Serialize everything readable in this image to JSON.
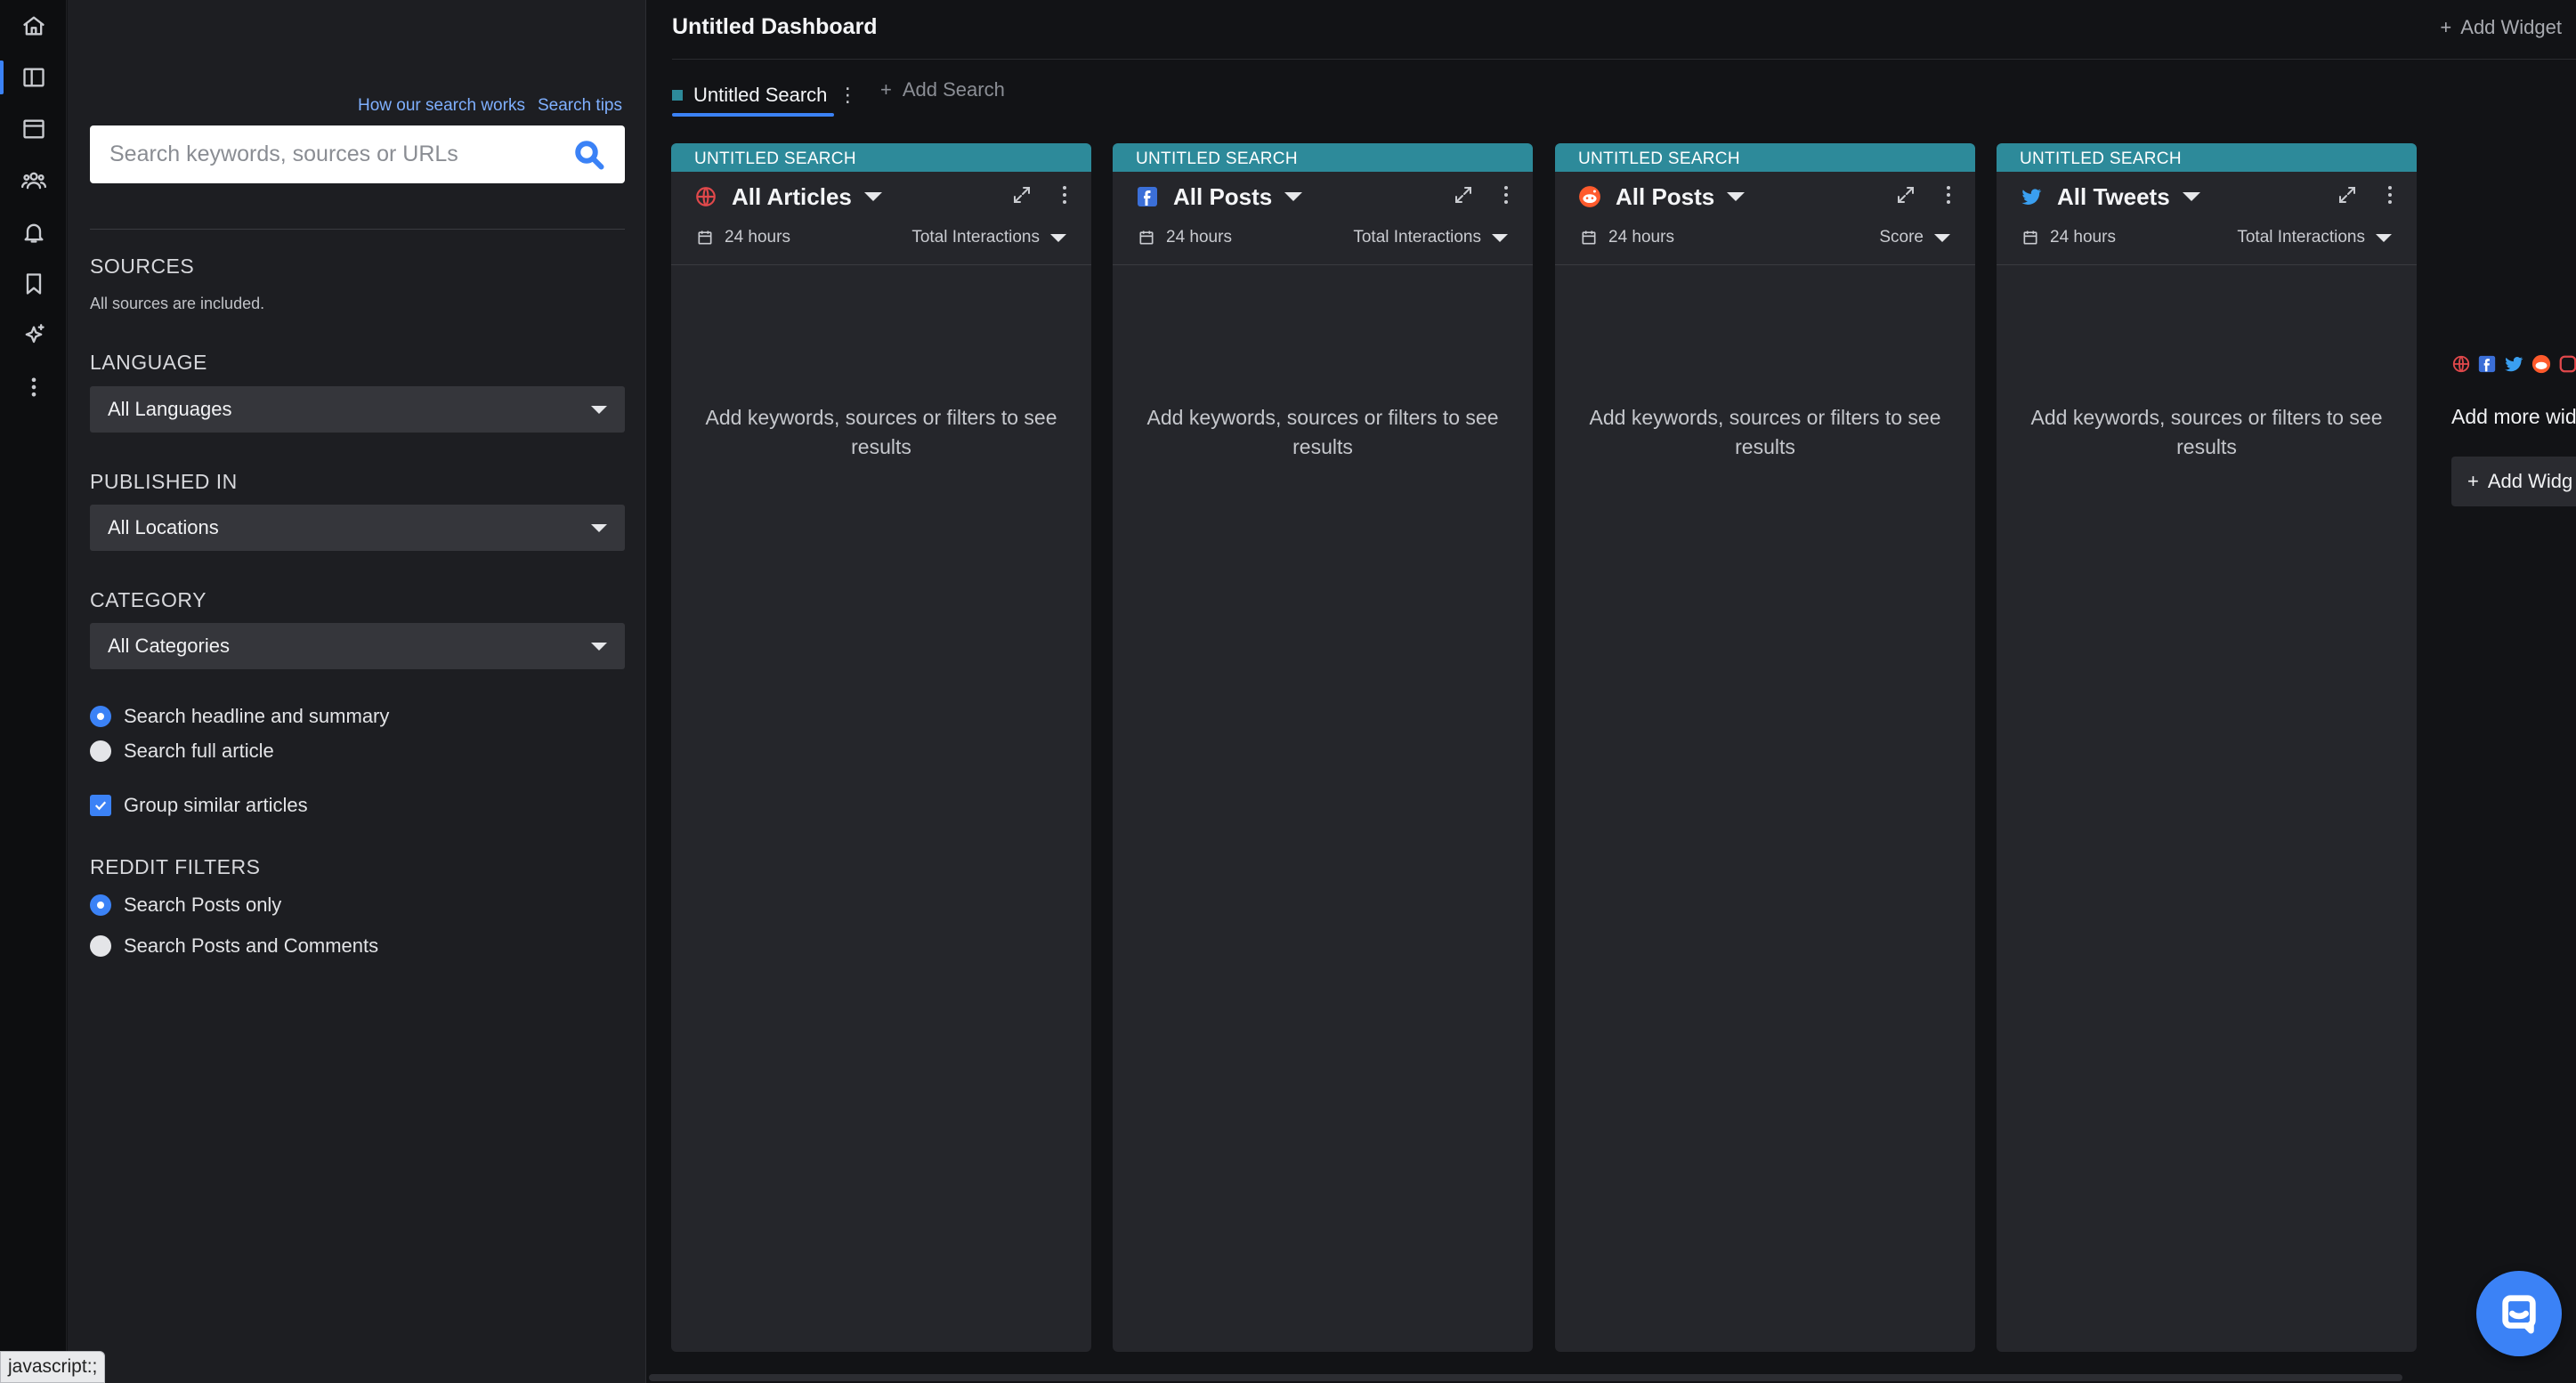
{
  "rail": {
    "items": [
      {
        "icon": "home-icon"
      },
      {
        "icon": "dashboard-icon"
      },
      {
        "icon": "window-icon"
      },
      {
        "icon": "people-icon"
      },
      {
        "icon": "bell-icon"
      },
      {
        "icon": "bookmark-icon"
      },
      {
        "icon": "sparkle-icon"
      },
      {
        "icon": "more-icon"
      }
    ]
  },
  "filters": {
    "help_link_1": "How our search works",
    "help_link_2": "Search tips",
    "search_placeholder": "Search keywords, sources or URLs",
    "sources_label": "SOURCES",
    "sources_note": "All sources are included.",
    "language_label": "LANGUAGE",
    "language_value": "All Languages",
    "published_label": "PUBLISHED IN",
    "published_value": "All Locations",
    "category_label": "CATEGORY",
    "category_value": "All Categories",
    "search_scope": {
      "option_1": "Search headline and summary",
      "option_2": "Search full article",
      "selected": "option_1"
    },
    "group_similar": {
      "label": "Group similar articles",
      "checked": true
    },
    "reddit_label": "REDDIT FILTERS",
    "reddit_scope": {
      "option_1": "Search Posts only",
      "option_2": "Search Posts and Comments",
      "selected": "option_1"
    }
  },
  "dashboard": {
    "title": "Untitled Dashboard",
    "add_widget": "Add Widget",
    "tab_label": "Untitled Search",
    "add_search": "Add Search",
    "columns": [
      {
        "header": "UNTITLED SEARCH",
        "source_icon": "globe-icon",
        "title": "All Articles",
        "time": "24 hours",
        "sort": "Total Interactions",
        "empty": "Add keywords, sources or filters to see results"
      },
      {
        "header": "UNTITLED SEARCH",
        "source_icon": "facebook-icon",
        "title": "All Posts",
        "time": "24 hours",
        "sort": "Total Interactions",
        "empty": "Add keywords, sources or filters to see results"
      },
      {
        "header": "UNTITLED SEARCH",
        "source_icon": "reddit-icon",
        "title": "All Posts",
        "time": "24 hours",
        "sort": "Score",
        "empty": "Add keywords, sources or filters to see results"
      },
      {
        "header": "UNTITLED SEARCH",
        "source_icon": "twitter-icon",
        "title": "All Tweets",
        "time": "24 hours",
        "sort": "Total Interactions",
        "empty": "Add keywords, sources or filters to see results"
      }
    ],
    "promo_text": "Add more wid",
    "promo_button": "Add Widg"
  },
  "status_url": "javascript:;",
  "colors": {
    "accent": "#3b82f6",
    "column_header": "#2d8a9a",
    "panel_bg": "#1d1e22",
    "column_bg": "#25262b"
  }
}
